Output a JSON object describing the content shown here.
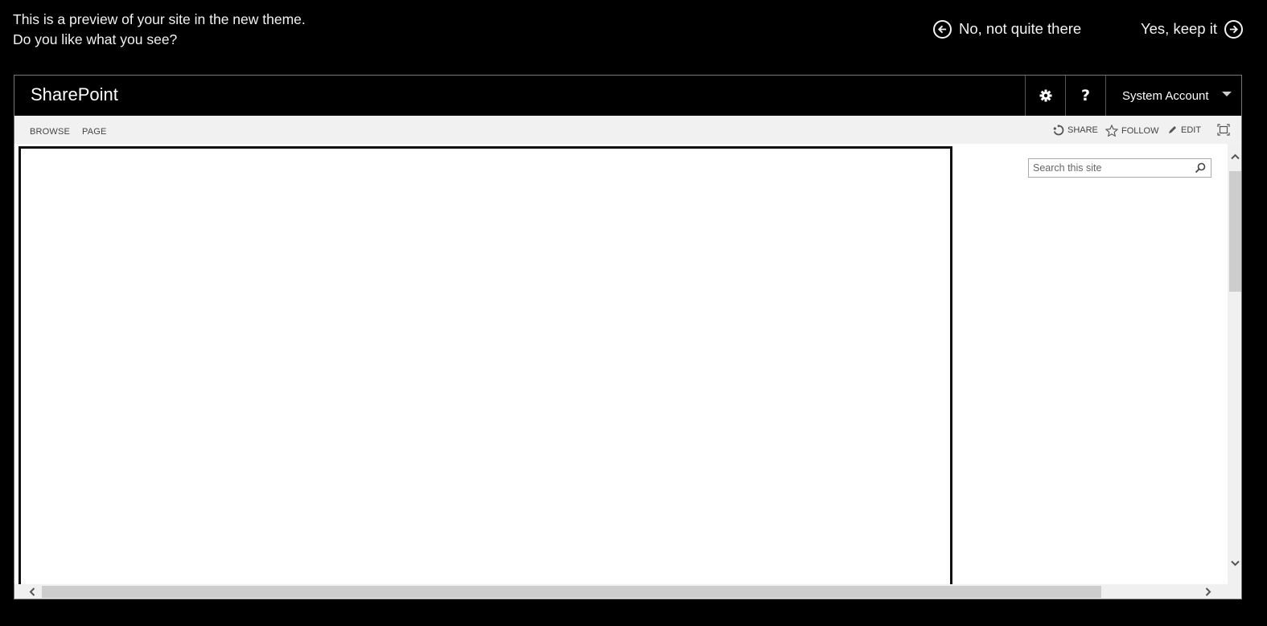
{
  "banner": {
    "line1": "This is a preview of your site in the new theme.",
    "line2": "Do you like what you see?",
    "no_label": "No, not quite there",
    "yes_label": "Yes, keep it"
  },
  "suitebar": {
    "brand": "SharePoint",
    "gear_icon": "gear-icon",
    "help_label": "?",
    "account_name": "System Account"
  },
  "ribbon": {
    "tabs": [
      {
        "label": "BROWSE"
      },
      {
        "label": "PAGE"
      }
    ],
    "actions": {
      "share": "SHARE",
      "follow": "FOLLOW",
      "edit": "EDIT"
    }
  },
  "search": {
    "placeholder": "Search this site"
  }
}
